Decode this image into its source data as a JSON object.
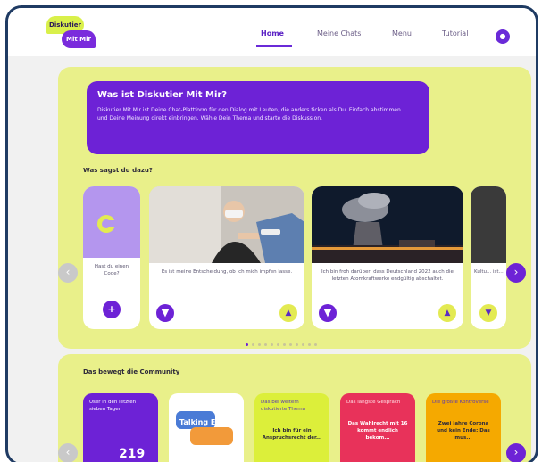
{
  "logo": {
    "line1": "Diskutier",
    "line2": "Mit Mir"
  },
  "nav": {
    "items": [
      {
        "label": "Home",
        "active": true
      },
      {
        "label": "Meine Chats",
        "active": false
      },
      {
        "label": "Menu",
        "active": false
      },
      {
        "label": "Tutorial",
        "active": false
      }
    ],
    "avatar_icon": "user-icon"
  },
  "intro": {
    "title": "Was ist Diskutier Mit Mir?",
    "text": "Diskutier Mit Mir ist Deine Chat-Plattform für den Dialog mit Leuten, die anders ticken als Du. Einfach abstimmen und Deine Meinung direkt einbringen. Wähle Dein Thema und starte die Diskussion."
  },
  "section1": {
    "title": "Was sagst du dazu?",
    "code_card": {
      "text": "Hast du einen Code?",
      "icon": "plus-icon"
    },
    "cards": [
      {
        "text": "Es ist meine Entscheidung, ob ich mich impfen lasse.",
        "image": "vaccination-photo"
      },
      {
        "text": "Ich bin froh darüber, dass Deutschland 2022 auch die letzten Atomkraftwerke endgültig abschaltet.",
        "image": "power-plant-photo"
      },
      {
        "text": "Kultu... ist..."
      }
    ],
    "dots_total": 12,
    "dots_active": 0
  },
  "section2": {
    "title": "Das bewegt die Community",
    "tiles": [
      {
        "header": "User in den letzten sieben Tagen",
        "value": "219",
        "color": "#6d22d6"
      },
      {
        "header": "Talking Europe",
        "color": "#ffffff"
      },
      {
        "header": "Das bei weitem diskutierte Thema",
        "body": "Ich bin für ein Anspruchsrecht der...",
        "color": "#dcef3a"
      },
      {
        "header": "Das längste Gespräch",
        "body": "Das Wahlrecht mit 16 kommt endlich bekom...",
        "color": "#e8325a"
      },
      {
        "header": "Die größte Kontroverse",
        "body": "Zwei Jahre Corona und kein Ende: Das mus...",
        "color": "#f5a900"
      }
    ]
  },
  "colors": {
    "accent": "#6d22d6",
    "lime": "#e9f08a",
    "frame": "#1f3b63"
  }
}
